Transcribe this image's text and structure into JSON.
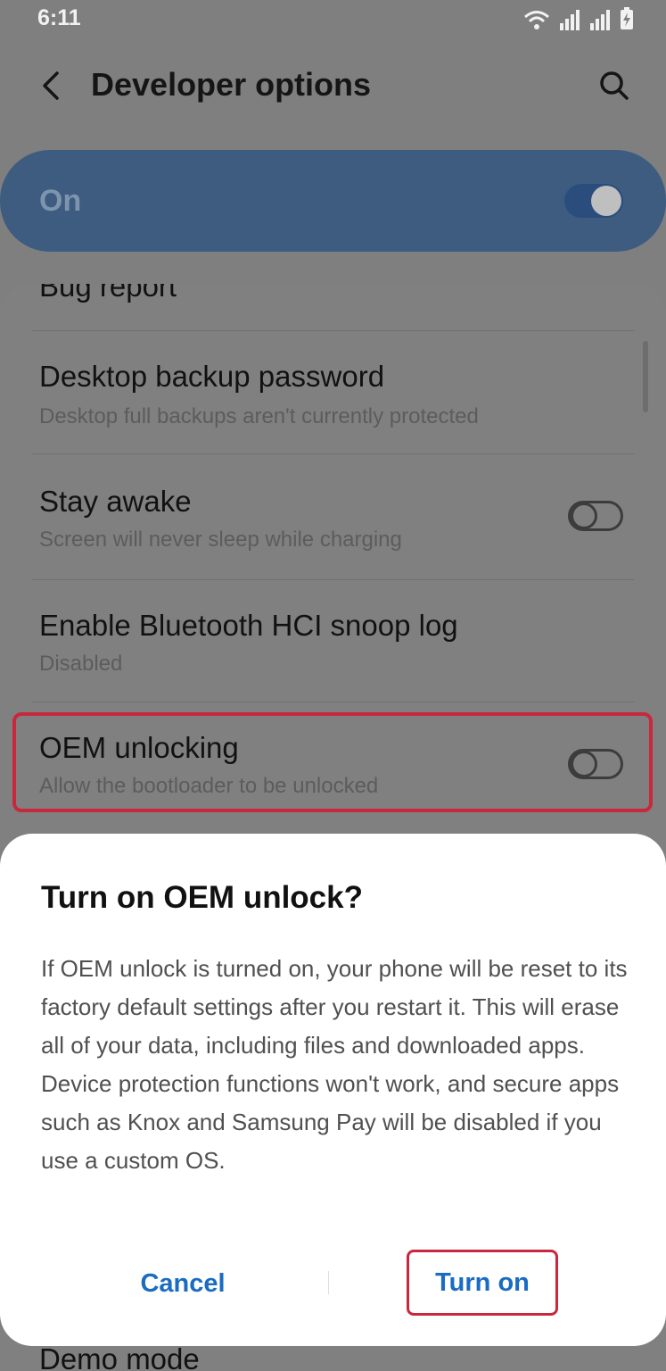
{
  "status_bar": {
    "time": "6:11"
  },
  "app_bar": {
    "title": "Developer options"
  },
  "master_switch": {
    "label": "On",
    "checked": true
  },
  "settings": {
    "bug_report": {
      "title": "Bug report"
    },
    "desktop_backup": {
      "title": "Desktop backup password",
      "subtitle": "Desktop full backups aren't currently protected"
    },
    "stay_awake": {
      "title": "Stay awake",
      "subtitle": "Screen will never sleep while charging",
      "checked": false
    },
    "bluetooth_hci": {
      "title": "Enable Bluetooth HCI snoop log",
      "subtitle": "Disabled"
    },
    "oem_unlocking": {
      "title": "OEM unlocking",
      "subtitle": "Allow the bootloader to be unlocked",
      "checked": false
    },
    "demo_mode": {
      "title": "Demo mode"
    }
  },
  "dialog": {
    "title": "Turn on OEM unlock?",
    "body": "If OEM unlock is turned on, your phone will be reset to its factory default settings after you restart it. This will erase all of your data, including files and downloaded apps. Device protection functions won't work, and secure apps such as Knox and Samsung Pay will be disabled if you use a custom OS.",
    "cancel_label": "Cancel",
    "confirm_label": "Turn on"
  },
  "colors": {
    "accent": "#1a6bc2",
    "highlight": "#c8283d",
    "master_bar": "#3d5c80"
  }
}
